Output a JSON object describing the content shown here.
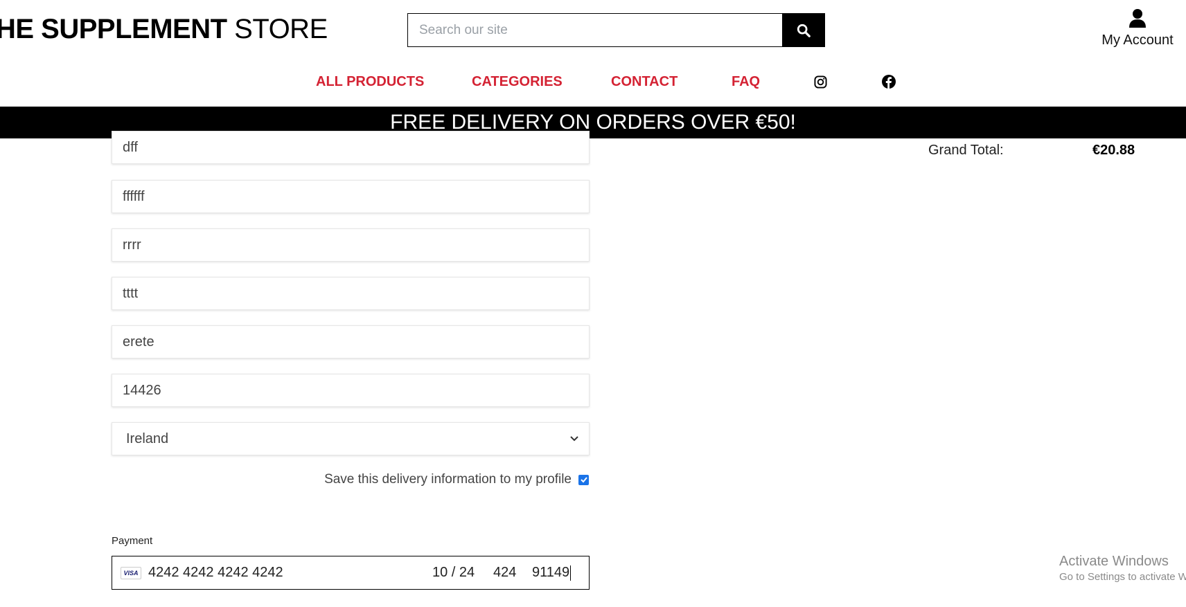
{
  "header": {
    "logo_bold": "HE SUPPLEMENT",
    "logo_regular": "STORE",
    "search_placeholder": "Search our site",
    "account_label": "My Account"
  },
  "nav": {
    "items": [
      {
        "label": "ALL PRODUCTS"
      },
      {
        "label": "CATEGORIES"
      },
      {
        "label": "CONTACT"
      },
      {
        "label": "FAQ"
      }
    ],
    "social": [
      "instagram-icon",
      "facebook-icon"
    ],
    "accent_color": "#d42233"
  },
  "banner": {
    "text": "FREE DELIVERY ON ORDERS OVER €50!"
  },
  "form": {
    "fields": [
      {
        "value": "dff"
      },
      {
        "value": "ffffff"
      },
      {
        "value": "rrrr"
      },
      {
        "value": "tttt"
      },
      {
        "value": "erete"
      },
      {
        "value": "14426"
      }
    ],
    "country": "Ireland",
    "save_label": "Save this delivery information to my profile",
    "save_checked": true,
    "payment_label": "Payment",
    "card": {
      "brand": "VISA",
      "number": "4242 4242 4242 4242",
      "expiry": "10 / 24",
      "cvc": "424",
      "postal": "91149"
    }
  },
  "summary": {
    "grand_total_label": "Grand Total:",
    "grand_total_value": "€20.88"
  },
  "os_watermark": {
    "title": "Activate Windows",
    "subtitle": "Go to Settings to activate Windows."
  }
}
